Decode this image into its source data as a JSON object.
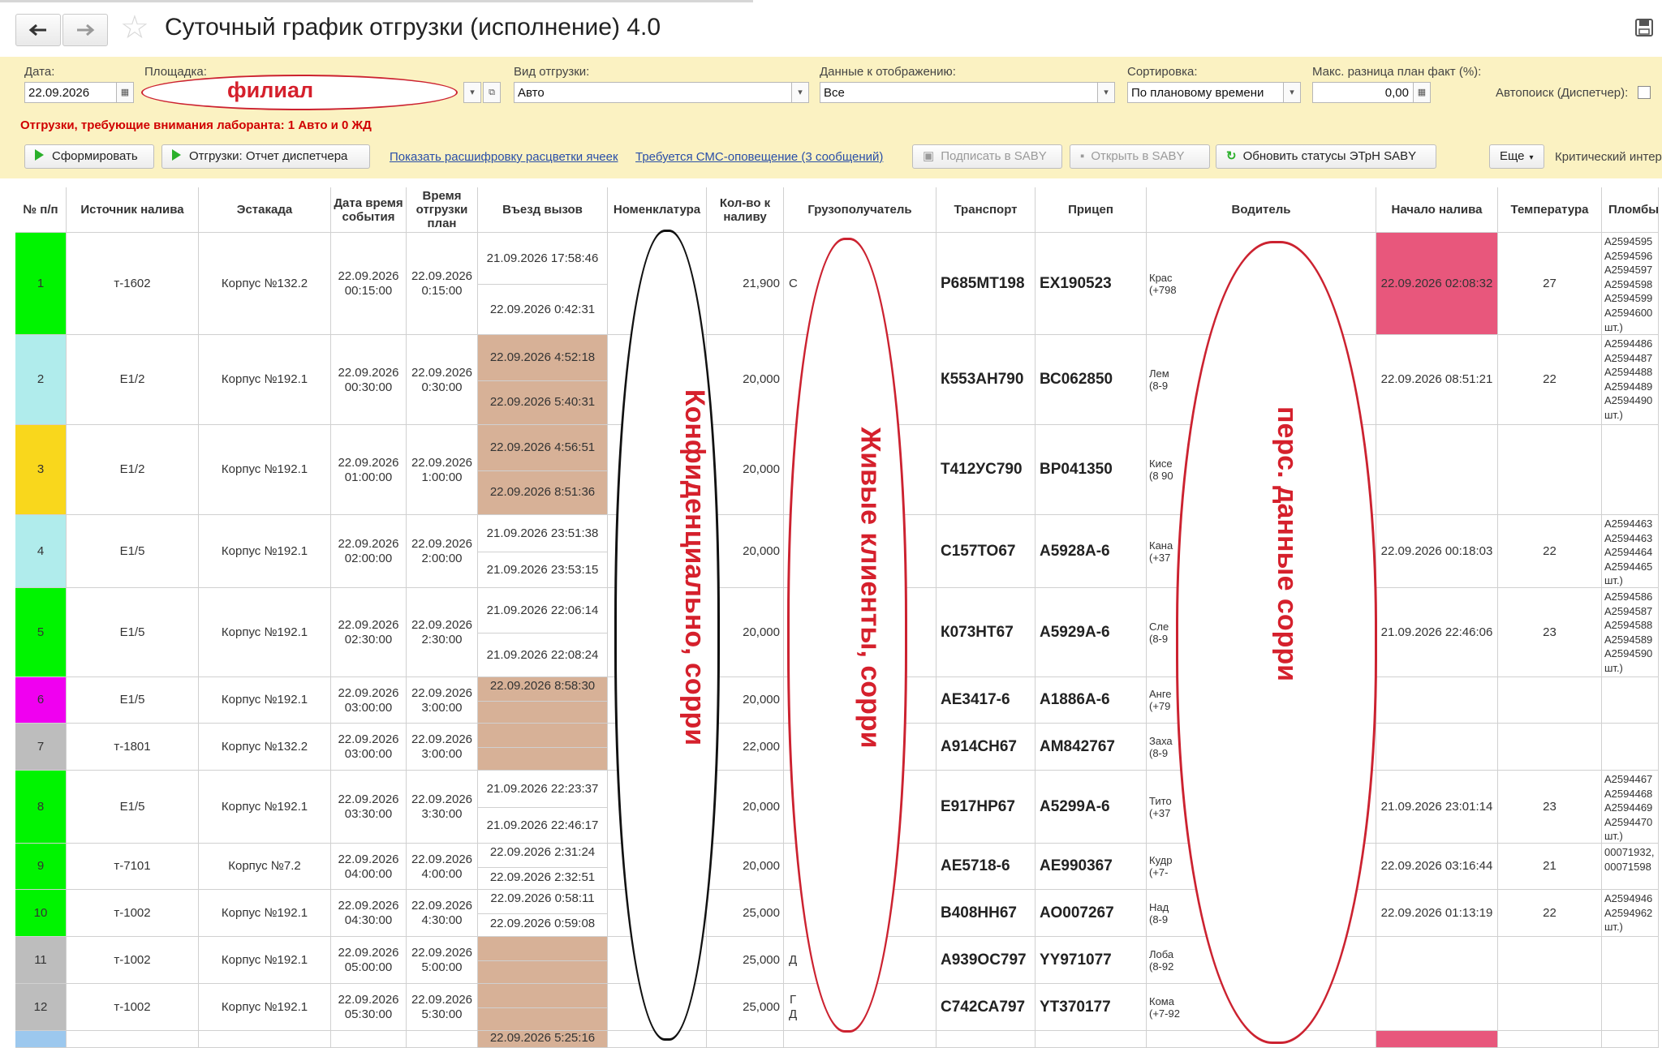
{
  "window": {
    "title": "Суточный график отгрузки (исполнение) 4.0"
  },
  "filters": {
    "date_label": "Дата:",
    "date_value": "22.09.2026",
    "site_label": "Площадка:",
    "site_redaction": "филиал",
    "shipment_type_label": "Вид отгрузки:",
    "shipment_type_value": "Авто",
    "display_label": "Данные к отображению:",
    "display_value": "Все",
    "sort_label": "Сортировка:",
    "sort_value": "По плановому времени",
    "maxdiff_label": "Макс. разница план факт (%):",
    "maxdiff_value": "0,00",
    "autosearch_label": "Автопоиск (Диспетчер):"
  },
  "warning": "Отгрузки, требующие внимания лаборанта: 1 Авто и 0 ЖД",
  "toolbar": {
    "form": "Сформировать",
    "report": "Отгрузки: Отчет диспетчера",
    "link_legend": "Показать расшифровку расцветки ячеек",
    "link_sms": "Требуется СМС-оповещение (3 сообщений)",
    "sign_saby": "Подписать в SABY",
    "open_saby": "Открыть в SABY",
    "update_saby": "Обновить статусы ЭТрН SABY",
    "more": "Еще",
    "critical": "Критический интервал"
  },
  "columns": [
    "№ п/п",
    "Источник налива",
    "Эстакада",
    "Дата время события",
    "Время отгрузки план",
    "Въезд вызов",
    "Номенклатура",
    "Кол-во к наливу",
    "Грузополучатель",
    "Транспорт",
    "Прицеп",
    "Водитель",
    "Начало налива",
    "Температура",
    "Пломбы"
  ],
  "redactions": {
    "nomenclature": "Конфиденциально, сорри",
    "consignee": "Живые клиенты, сорри",
    "driver": "перс. данные сорри"
  },
  "rows": [
    {
      "n": "1",
      "color": "#00f400",
      "src": "т-1602",
      "rack": "Корпус №132.2",
      "ev1": "22.09.2026",
      "ev2": "00:15:00",
      "pl1": "22.09.2026",
      "pl2": "0:15:00",
      "in1": "21.09.2026 17:58:46",
      "in2": "22.09.2026 0:42:31",
      "inbg": "#fff",
      "qty": "21,900",
      "cons": "С",
      "tr": "Р685МТ198",
      "trl": "ЕХ190523",
      "drv1": "Крас",
      "drv2": "(+798",
      "start": "22.09.2026 02:08:32",
      "startbg": "#e8577c",
      "temp": "27",
      "seals": "A2594595\nA2594596\nA2594597\nA2594598\nA2594599\nA2594600\nшт.)"
    },
    {
      "n": "2",
      "color": "#b0ecec",
      "src": "Е1/2",
      "rack": "Корпус №192.1",
      "ev1": "22.09.2026",
      "ev2": "00:30:00",
      "pl1": "22.09.2026",
      "pl2": "0:30:00",
      "in1": "22.09.2026 4:52:18",
      "in2": "22.09.2026 5:40:31",
      "inbg": "#d7b197",
      "qty": "20,000",
      "cons": "",
      "tr": "К553АН790",
      "trl": "ВС062850",
      "drv1": "Лем",
      "drv2": "(8-9",
      "start": "22.09.2026 08:51:21",
      "startbg": "#fff",
      "temp": "22",
      "seals": "A2594486\nA2594487\nA2594488\nA2594489\nA2594490\nшт.)"
    },
    {
      "n": "3",
      "color": "#f9d71c",
      "src": "Е1/2",
      "rack": "Корпус №192.1",
      "ev1": "22.09.2026",
      "ev2": "01:00:00",
      "pl1": "22.09.2026",
      "pl2": "1:00:00",
      "in1": "22.09.2026 4:56:51",
      "in2": "22.09.2026 8:51:36",
      "inbg": "#d7b197",
      "qty": "20,000",
      "cons": "",
      "tr": "Т412УС790",
      "trl": "ВР041350",
      "drv1": "Кисе",
      "drv2": "(8 90",
      "start": "",
      "startbg": "#fff",
      "temp": "",
      "seals": ""
    },
    {
      "n": "4",
      "color": "#b0ecec",
      "src": "Е1/5",
      "rack": "Корпус №192.1",
      "ev1": "22.09.2026",
      "ev2": "02:00:00",
      "pl1": "22.09.2026",
      "pl2": "2:00:00",
      "in1": "21.09.2026 23:51:38",
      "in2": "21.09.2026 23:53:15",
      "inbg": "#fff",
      "qty": "20,000",
      "cons": "",
      "tr": "С157ТО67",
      "trl": "А5928А-6",
      "drv1": "Кана",
      "drv2": "(+37",
      "start": "22.09.2026 00:18:03",
      "startbg": "#fff",
      "temp": "22",
      "seals": "A2594463\nA2594463\nA2594464\nA2594465\nшт.)"
    },
    {
      "n": "5",
      "color": "#00f400",
      "src": "Е1/5",
      "rack": "Корпус №192.1",
      "ev1": "22.09.2026",
      "ev2": "02:30:00",
      "pl1": "22.09.2026",
      "pl2": "2:30:00",
      "in1": "21.09.2026 22:06:14",
      "in2": "21.09.2026 22:08:24",
      "inbg": "#fff",
      "qty": "20,000",
      "cons": "",
      "tr": "К073НТ67",
      "trl": "А5929А-6",
      "drv1": "Сле",
      "drv2": "(8-9",
      "start": "21.09.2026 22:46:06",
      "startbg": "#fff",
      "temp": "23",
      "seals": "A2594586\nA2594587\nA2594588\nA2594589\nA2594590\nшт.)"
    },
    {
      "n": "6",
      "color": "#f000f0",
      "src": "Е1/5",
      "rack": "Корпус №192.1",
      "ev1": "22.09.2026",
      "ev2": "03:00:00",
      "pl1": "22.09.2026",
      "pl2": "3:00:00",
      "in1": "22.09.2026 8:58:30",
      "in2": "",
      "inbg": "#d7b197",
      "qty": "20,000",
      "cons": "",
      "tr": "АЕ3417-6",
      "trl": "А1886А-6",
      "drv1": "Анге",
      "drv2": "(+79",
      "start": "",
      "startbg": "#fff",
      "temp": "",
      "seals": ""
    },
    {
      "n": "7",
      "color": "#bdbdbd",
      "src": "т-1801",
      "rack": "Корпус №132.2",
      "ev1": "22.09.2026",
      "ev2": "03:00:00",
      "pl1": "22.09.2026",
      "pl2": "3:00:00",
      "in1": "",
      "in2": "",
      "inbg": "#d7b197",
      "qty": "22,000",
      "cons": "",
      "tr": "А914СН67",
      "trl": "АМ842767",
      "drv1": "Заха",
      "drv2": "(8-9",
      "start": "",
      "startbg": "#fff",
      "temp": "",
      "seals": ""
    },
    {
      "n": "8",
      "color": "#00f400",
      "src": "Е1/5",
      "rack": "Корпус №192.1",
      "ev1": "22.09.2026",
      "ev2": "03:30:00",
      "pl1": "22.09.2026",
      "pl2": "3:30:00",
      "in1": "21.09.2026 22:23:37",
      "in2": "21.09.2026 22:46:17",
      "inbg": "#fff",
      "qty": "20,000",
      "cons": "",
      "tr": "Е917НР67",
      "trl": "А5299А-6",
      "drv1": "Тито",
      "drv2": "(+37",
      "start": "21.09.2026 23:01:14",
      "startbg": "#fff",
      "temp": "23",
      "seals": "A2594467\nA2594468\nA2594469\nA2594470\nшт.)"
    },
    {
      "n": "9",
      "color": "#00f400",
      "src": "т-7101",
      "rack": "Корпус №7.2",
      "ev1": "22.09.2026",
      "ev2": "04:00:00",
      "pl1": "22.09.2026",
      "pl2": "4:00:00",
      "in1": "22.09.2026 2:31:24",
      "in2": "22.09.2026 2:32:51",
      "inbg": "#fff",
      "qty": "20,000",
      "cons": "",
      "tr": "АЕ5718-6",
      "trl": "АЕ990367",
      "drv1": "Кудр",
      "drv2": "(+7-",
      "start": "22.09.2026 03:16:44",
      "startbg": "#fff",
      "temp": "21",
      "seals": "00071932,\n00071598"
    },
    {
      "n": "10",
      "color": "#00f400",
      "src": "т-1002",
      "rack": "Корпус №192.1",
      "ev1": "22.09.2026",
      "ev2": "04:30:00",
      "pl1": "22.09.2026",
      "pl2": "4:30:00",
      "in1": "22.09.2026 0:58:11",
      "in2": "22.09.2026 0:59:08",
      "inbg": "#fff",
      "qty": "25,000",
      "cons": "",
      "tr": "В408НН67",
      "trl": "АО007267",
      "drv1": "Над",
      "drv2": "(8-9",
      "start": "22.09.2026 01:13:19",
      "startbg": "#fff",
      "temp": "22",
      "seals": "A2594946\nA2594962\nшт.)"
    },
    {
      "n": "11",
      "color": "#bdbdbd",
      "src": "т-1002",
      "rack": "Корпус №192.1",
      "ev1": "22.09.2026",
      "ev2": "05:00:00",
      "pl1": "22.09.2026",
      "pl2": "5:00:00",
      "in1": "",
      "in2": "",
      "inbg": "#d7b197",
      "qty": "25,000",
      "cons": "Д",
      "tr": "А939ОС797",
      "trl": "YY971077",
      "drv1": "Лоба",
      "drv2": "(8-92",
      "start": "",
      "startbg": "#fff",
      "temp": "",
      "seals": ""
    },
    {
      "n": "12",
      "color": "#bdbdbd",
      "src": "т-1002",
      "rack": "Корпус №192.1",
      "ev1": "22.09.2026",
      "ev2": "05:30:00",
      "pl1": "22.09.2026",
      "pl2": "5:30:00",
      "in1": "",
      "in2": "",
      "inbg": "#d7b197",
      "qty": "25,000",
      "cons": "Г\nД",
      "tr": "С742СА797",
      "trl": "YT370177",
      "drv1": "Кома",
      "drv2": "(+7-92",
      "start": "",
      "startbg": "#fff",
      "temp": "",
      "seals": ""
    }
  ],
  "partial_row": {
    "in1": "22.09.2026 5:25:16"
  }
}
